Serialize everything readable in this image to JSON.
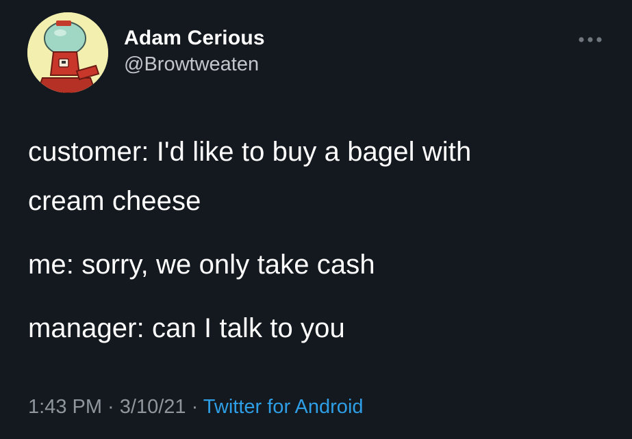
{
  "author": {
    "display_name": "Adam Cerious",
    "handle": "@Browtweaten"
  },
  "icons": {
    "more": "more-horizontal-icon",
    "avatar": "gumball-machine-avatar"
  },
  "tweet": {
    "paragraphs": [
      "customer: I'd like to buy a bagel with\ncream cheese",
      "me: sorry, we only take cash",
      "manager: can I talk to you"
    ]
  },
  "meta": {
    "time": "1:43 PM",
    "separator_1": " · ",
    "date": "3/10/21",
    "separator_2": " · ",
    "source": "Twitter for Android"
  },
  "colors": {
    "background": "#14191f",
    "text": "#ffffff",
    "secondary_text": "#8f969d",
    "link": "#2e9fe6"
  }
}
